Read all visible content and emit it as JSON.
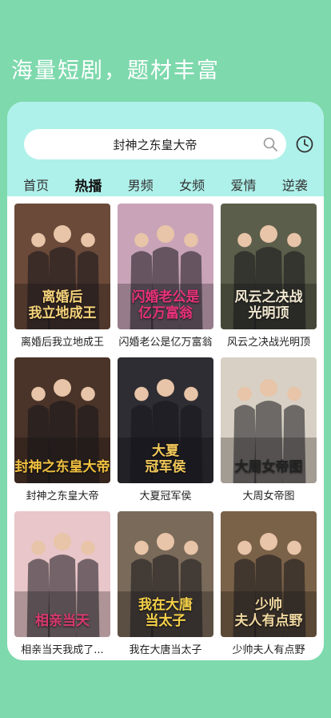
{
  "hero": {
    "title": "海量短剧，题材丰富"
  },
  "search": {
    "query": "封神之东皇大帝"
  },
  "tabs": [
    {
      "label": "首页"
    },
    {
      "label": "热播"
    },
    {
      "label": "男频"
    },
    {
      "label": "女频"
    },
    {
      "label": "爱情"
    },
    {
      "label": "逆袭"
    }
  ],
  "active_tab": "热播",
  "dramas": [
    {
      "title": "离婚后我立地成王",
      "poster_text": "离婚后\n我立地成王",
      "bg": "#6b4a3a",
      "accent": "#f5d37a"
    },
    {
      "title": "闪婚老公是亿万富翁",
      "poster_text": "闪婚老公是\n亿万富翁",
      "bg": "#c9a4b8",
      "accent": "#e8327a"
    },
    {
      "title": "风云之决战光明顶",
      "poster_text": "风云之决战\n光明顶",
      "bg": "#5b5e4a",
      "accent": "#f1e7d0"
    },
    {
      "title": "封神之东皇大帝",
      "poster_text": "封神之东皇大帝",
      "bg": "#4a3328",
      "accent": "#f0c040"
    },
    {
      "title": "大夏冠军侯",
      "poster_text": "大夏\n冠军侯",
      "bg": "#2e2d33",
      "accent": "#f2c95a"
    },
    {
      "title": "大周女帝图",
      "poster_text": "大周女帝图",
      "bg": "#d8d0c4",
      "accent": "#222222"
    },
    {
      "title": "相亲当天我成了...",
      "poster_text": "相亲当天",
      "bg": "#e9c6c9",
      "accent": "#d8396e"
    },
    {
      "title": "我在大唐当太子",
      "poster_text": "我在大唐\n当太子",
      "bg": "#7a6a5a",
      "accent": "#f6d24a"
    },
    {
      "title": "少帅夫人有点野",
      "poster_text": "少帅\n夫人有点野",
      "bg": "#7a6248",
      "accent": "#f0d8a0"
    }
  ]
}
